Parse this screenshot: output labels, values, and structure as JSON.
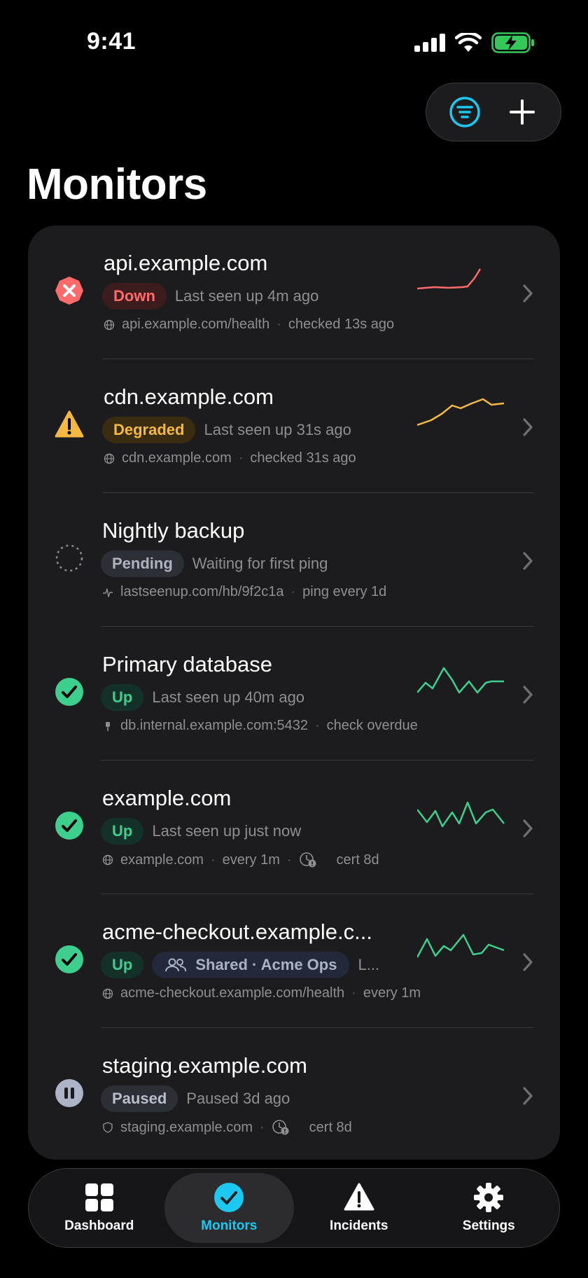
{
  "status_bar": {
    "time": "9:41"
  },
  "header": {
    "title": "Monitors"
  },
  "colors": {
    "accent": "#1cc8f0",
    "down": "#ff6b6b",
    "degraded": "#f5b942",
    "up": "#3ecf8e",
    "paused": "#aeb4c8"
  },
  "monitors": [
    {
      "name": "api.example.com",
      "status": "Down",
      "subtitle": "Last seen up 4m ago",
      "icon": "globe-icon",
      "target": "api.example.com/health",
      "meta": "checked 13s ago"
    },
    {
      "name": "cdn.example.com",
      "status": "Degraded",
      "subtitle": "Last seen up 31s ago",
      "icon": "globe-icon",
      "target": "cdn.example.com",
      "meta": "checked 31s ago"
    },
    {
      "name": "Nightly backup",
      "status": "Pending",
      "subtitle": "Waiting for first ping",
      "icon": "heartbeat-icon",
      "target": "lastseenup.com/hb/9f2c1a",
      "meta": "ping every 1d"
    },
    {
      "name": "Primary database",
      "status": "Up",
      "subtitle": "Last seen up 40m ago",
      "icon": "plug-icon",
      "target": "db.internal.example.com:5432",
      "meta": "check overdue"
    },
    {
      "name": "example.com",
      "status": "Up",
      "subtitle": "Last seen up just now",
      "icon": "globe-icon",
      "target": "example.com",
      "meta": "every 1m",
      "cert": "cert 8d"
    },
    {
      "name": "acme-checkout.example.c...",
      "status": "Up",
      "shared": "Shared · Acme Ops",
      "subtitle": "L...",
      "icon": "globe-icon",
      "target": "acme-checkout.example.com/health",
      "meta": "every 1m"
    },
    {
      "name": "staging.example.com",
      "status": "Paused",
      "subtitle": "Paused 3d ago",
      "icon": "shield-icon",
      "target": "staging.example.com",
      "cert": "cert 8d"
    }
  ],
  "tabs": [
    {
      "label": "Dashboard"
    },
    {
      "label": "Monitors"
    },
    {
      "label": "Incidents"
    },
    {
      "label": "Settings"
    }
  ]
}
